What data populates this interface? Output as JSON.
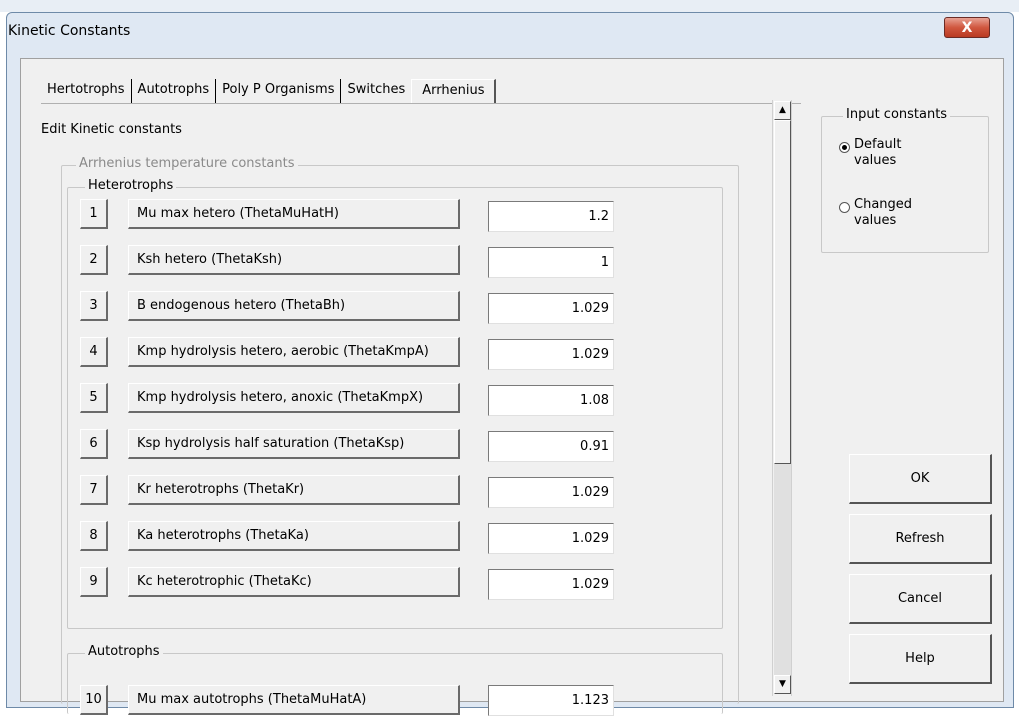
{
  "window": {
    "title": "Kinetic Constants",
    "close_label": "X"
  },
  "tabs": [
    "Hertotrophs",
    "Autotrophs",
    "Poly P Organisms",
    "Switches",
    "Arrhenius"
  ],
  "active_tab": "Arrhenius",
  "edit_label": "Edit Kinetic constants",
  "outer_group": "Arrhenius temperature constants",
  "heterotrophs": {
    "label": "Heterotrophs",
    "rows": [
      {
        "num": "1",
        "name": "Mu max hetero (ThetaMuHatH)",
        "value": "1.2"
      },
      {
        "num": "2",
        "name": "Ksh hetero (ThetaKsh)",
        "value": "1"
      },
      {
        "num": "3",
        "name": "B endogenous hetero (ThetaBh)",
        "value": "1.029"
      },
      {
        "num": "4",
        "name": "Kmp hydrolysis hetero, aerobic (ThetaKmpA)",
        "value": "1.029"
      },
      {
        "num": "5",
        "name": "Kmp hydrolysis hetero, anoxic (ThetaKmpX)",
        "value": "1.08"
      },
      {
        "num": "6",
        "name": "Ksp hydrolysis half saturation (ThetaKsp)",
        "value": "0.91"
      },
      {
        "num": "7",
        "name": "Kr heterotrophs (ThetaKr)",
        "value": "1.029"
      },
      {
        "num": "8",
        "name": "Ka heterotrophs (ThetaKa)",
        "value": "1.029"
      },
      {
        "num": "9",
        "name": "Kc heterotrophic (ThetaKc)",
        "value": "1.029"
      }
    ]
  },
  "autotrophs": {
    "label": "Autotrophs",
    "row": {
      "num": "10",
      "name": "Mu max autotrophs (ThetaMuHatA)",
      "value": "1.123"
    }
  },
  "input_constants": {
    "label": "Input constants",
    "default_line1": "Default",
    "default_line2": "values",
    "changed_line1": "Changed",
    "changed_line2": "values",
    "selected": "default"
  },
  "buttons": {
    "ok": "OK",
    "refresh": "Refresh",
    "cancel": "Cancel",
    "help": "Help"
  },
  "scroll_icons": {
    "up": "▲",
    "down": "▼"
  }
}
